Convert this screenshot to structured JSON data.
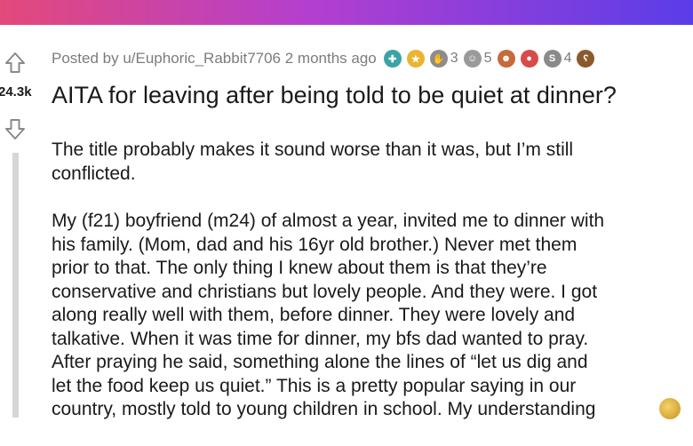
{
  "post": {
    "meta_text": "Posted by u/Euphoric_Rabbit7706 2 months ago",
    "score": "24.3k",
    "title": "AITA for leaving after being told to be quiet at dinner?",
    "awards": [
      {
        "icon": "helpful-award-icon",
        "color": "#3aa3a7",
        "count": ""
      },
      {
        "icon": "gold-award-icon",
        "color": "#e9b530",
        "count": ""
      },
      {
        "icon": "hand-award-icon",
        "color": "#8c8c8c",
        "count": "3"
      },
      {
        "icon": "face-award-icon",
        "color": "#9a9a9a",
        "count": "5"
      },
      {
        "icon": "laugh-award-icon",
        "color": "#c46a3b",
        "count": ""
      },
      {
        "icon": "eyes-award-icon",
        "color": "#d84b4b",
        "count": ""
      },
      {
        "icon": "silver-award-icon",
        "color": "#8a8a8a",
        "count": "4"
      },
      {
        "icon": "bear-award-icon",
        "color": "#8b5a2b",
        "count": ""
      }
    ],
    "paragraphs": [
      "The title probably makes it sound worse than it was, but I’m still\nconflicted.",
      "My (f21) boyfriend (m24) of almost a year, invited me to dinner with\nhis family. (Mom, dad and his 16yr old brother.) Never met them\nprior to that. The only thing I knew about them is that they’re\nconservative and christians but lovely people. And they were. I got\nalong really well with them, before dinner. They were lovely and\ntalkative. When it was time for dinner, my bfs dad wanted to pray.\nAfter praying he said, something alone the lines of “let us dig and\nlet the food keep us quiet.” This is a pretty popular saying in our\ncountry, mostly told to young children in school. My understanding"
    ]
  },
  "colors": {
    "text": "#1a1a1b",
    "meta": "#7c7c7c",
    "thread_line": "#d6d6d6"
  }
}
